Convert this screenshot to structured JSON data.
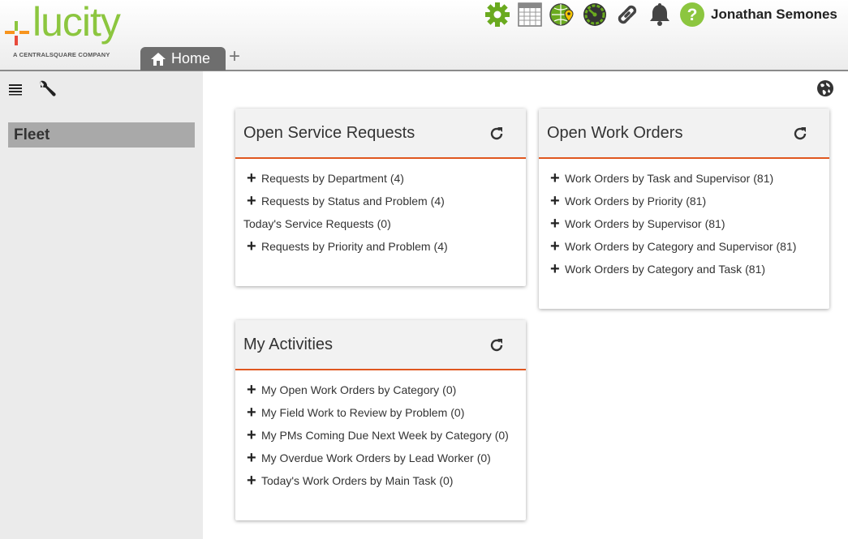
{
  "header": {
    "logo_text": "lucity",
    "logo_subtitle": "A CENTRALSQUARE COMPANY",
    "tabs": [
      {
        "label": "Home",
        "icon": "home-icon"
      }
    ],
    "add_tab_label": "+",
    "toolbar_icons": [
      "gear-icon",
      "calendar-icon",
      "map-pin-globe-icon",
      "dashboard-gauge-icon",
      "link-icon",
      "bell-icon",
      "help-icon"
    ],
    "user_name": "Jonathan Semones"
  },
  "sidebar": {
    "tools": [
      "list-icon",
      "wrench-icon"
    ],
    "active_item": "Fleet"
  },
  "panels": [
    {
      "title": "Open Service Requests",
      "items": [
        {
          "label": "Requests by Department",
          "count": "(4)",
          "expandable": true
        },
        {
          "label": "Requests by Status and Problem",
          "count": "(4)",
          "expandable": true
        },
        {
          "label": "Today's Service Requests",
          "count": "(0)",
          "expandable": false
        },
        {
          "label": "Requests by Priority and Problem",
          "count": "(4)",
          "expandable": true
        }
      ]
    },
    {
      "title": "Open Work Orders",
      "items": [
        {
          "label": "Work Orders by Task and Supervisor",
          "count": "(81)",
          "expandable": true
        },
        {
          "label": "Work Orders by Priority",
          "count": "(81)",
          "expandable": true
        },
        {
          "label": "Work Orders by Supervisor",
          "count": "(81)",
          "expandable": true
        },
        {
          "label": "Work Orders by Category and Supervisor",
          "count": "(81)",
          "expandable": true
        },
        {
          "label": "Work Orders by Category and Task",
          "count": "(81)",
          "expandable": true
        }
      ]
    },
    {
      "title": "My Activities",
      "items": [
        {
          "label": "My Open Work Orders by Category",
          "count": "(0)",
          "expandable": true
        },
        {
          "label": "My Field Work to Review by Problem",
          "count": "(0)",
          "expandable": true
        },
        {
          "label": "My PMs Coming Due Next Week by Category",
          "count": "(0)",
          "expandable": true
        },
        {
          "label": "My Overdue Work Orders by Lead Worker",
          "count": "(0)",
          "expandable": true
        },
        {
          "label": "Today's Work Orders by Main Task",
          "count": "(0)",
          "expandable": true
        }
      ]
    }
  ],
  "colors": {
    "accent": "#e0571f",
    "brand_green": "#8cc63f",
    "tab": "#6e6e6e"
  }
}
